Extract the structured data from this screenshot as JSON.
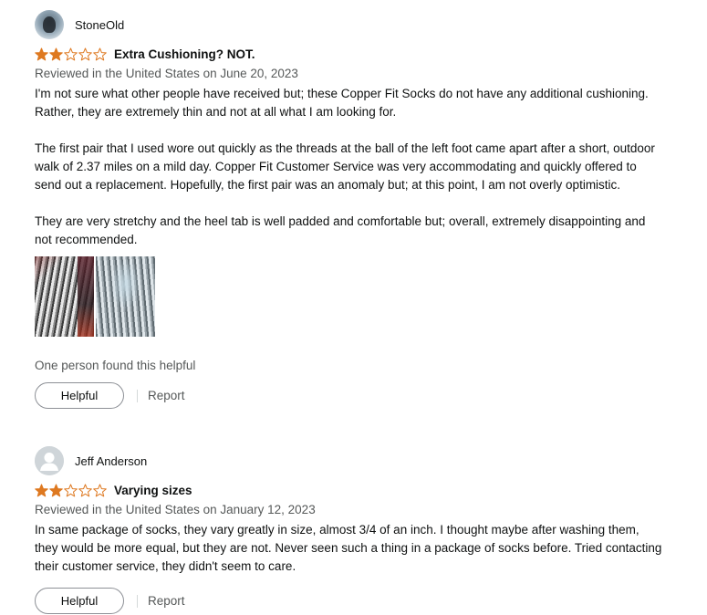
{
  "colors": {
    "star_filled": "#de7921",
    "star_outline": "#de7921",
    "text_primary": "#0f1111",
    "text_secondary": "#565959",
    "button_border": "#8d9096"
  },
  "reviews": [
    {
      "reviewer": "StoneOld",
      "avatar": "reviewer-photo-icon",
      "rating": 2,
      "rating_max": 5,
      "title": "Extra Cushioning? NOT.",
      "date": "Reviewed in the United States on June 20, 2023",
      "paragraphs": [
        "I'm not sure what other people have received but; these Copper Fit Socks do not have any additional cushioning. Rather, they are extremely thin and not at all what I am looking for.",
        "The first pair that I used wore out quickly as the threads at the ball of the left foot came apart after a short, outdoor walk of 2.37 miles on a mild day. Copper Fit Customer Service was very accommodating and quickly offered to send out a replacement. Hopefully, the first pair was an anomaly but; at this point, I am not overly optimistic.",
        "They are very stretchy and the heel tab is well padded and comfortable but; overall, extremely disappointing and not recommended."
      ],
      "images": [
        "sock-photo-1",
        "sock-photo-2"
      ],
      "helpful_count": "One person found this helpful",
      "helpful_label": "Helpful",
      "report_label": "Report"
    },
    {
      "reviewer": "Jeff Anderson",
      "avatar": "default-user-icon",
      "rating": 2,
      "rating_max": 5,
      "title": "Varying sizes",
      "date": "Reviewed in the United States on January 12, 2023",
      "paragraphs": [
        "In same package of socks, they vary greatly in size, almost 3/4 of an inch. I thought maybe after washing them, they would be more equal, but they are not. Never seen such a thing in a package of socks before. Tried contacting their customer service, they didn't seem to care."
      ],
      "helpful_label": "Helpful",
      "report_label": "Report"
    }
  ]
}
